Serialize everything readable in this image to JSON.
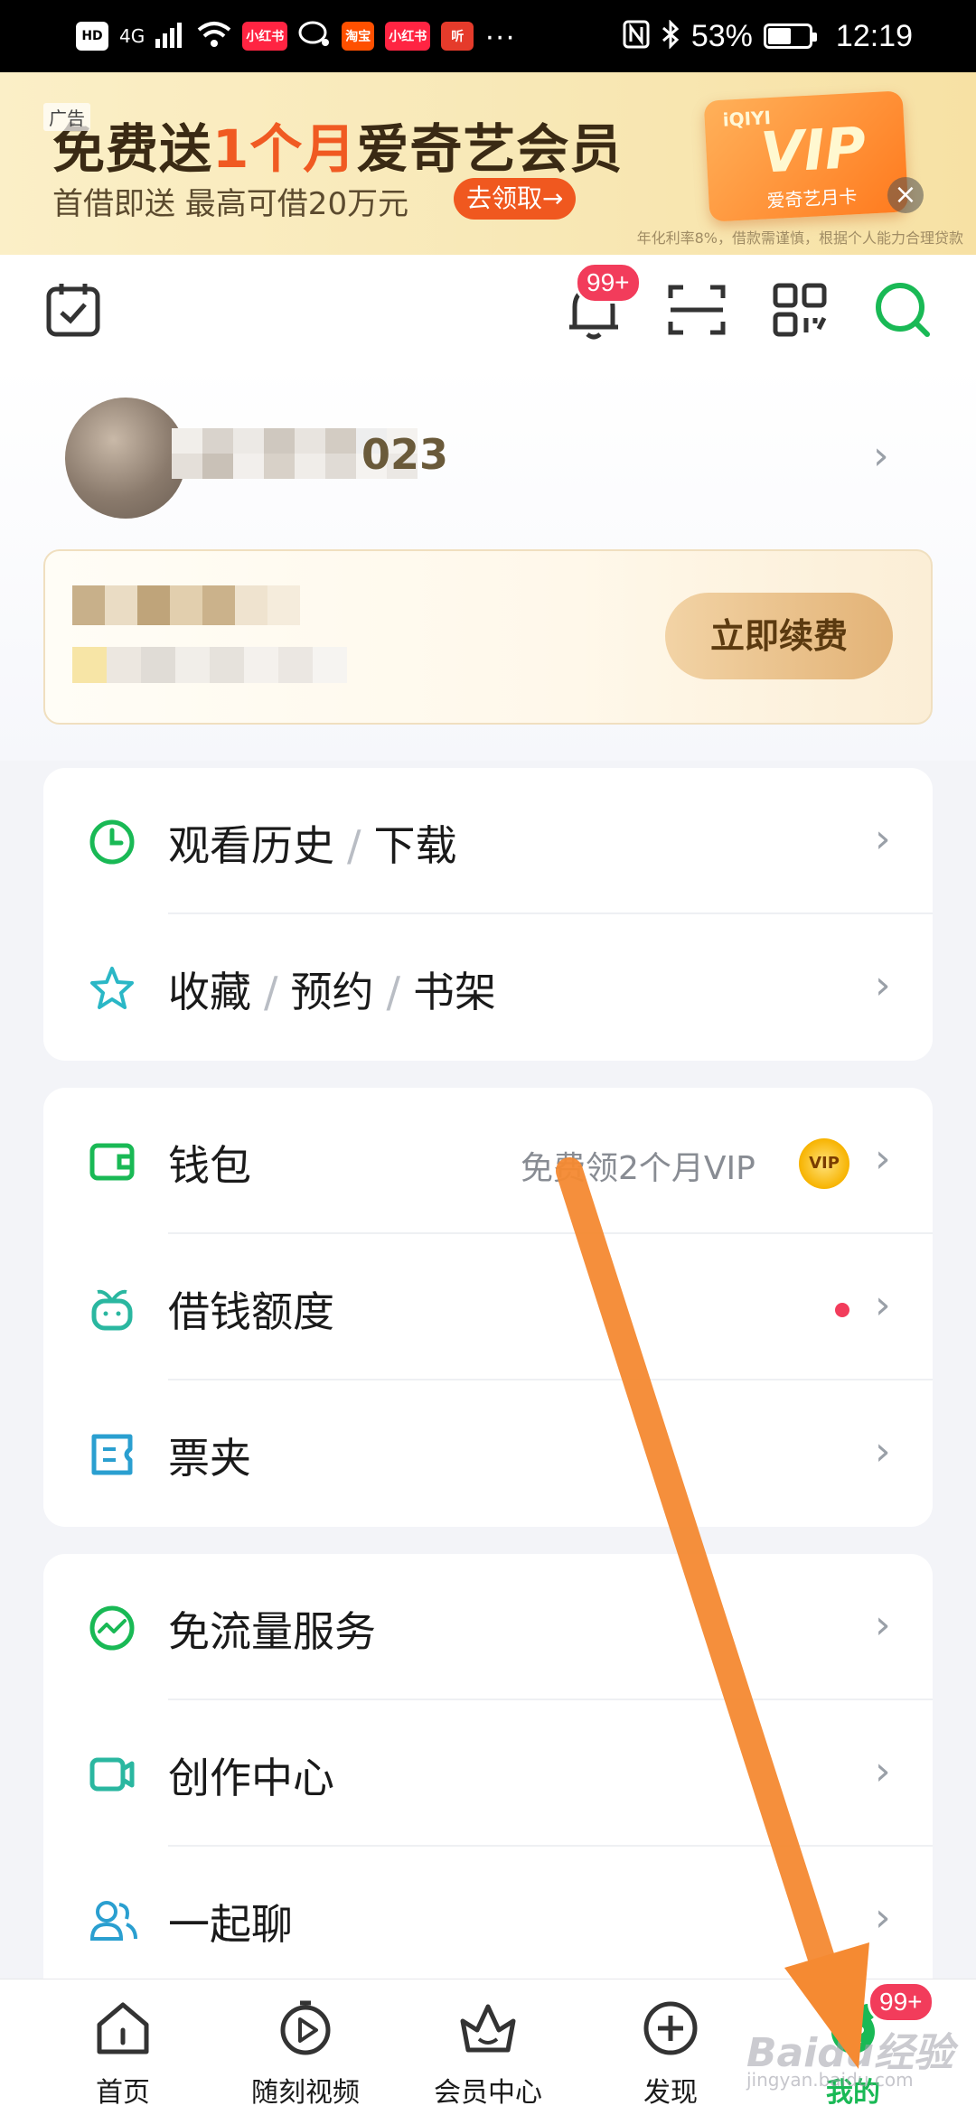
{
  "status_bar": {
    "network_label": "4G",
    "app_chips": [
      "HD",
      "小红书",
      "淘宝",
      "小红书",
      "听"
    ],
    "more": "···",
    "battery": "53%",
    "time": "12:19"
  },
  "ad": {
    "tag": "广告",
    "title_pre": "免费送",
    "title_highlight": "1个月",
    "title_post": "爱奇艺会员",
    "subtitle": "首借即送  最高可借20万元",
    "button": "去领取→",
    "disclaimer": "年化利率8%，借款需谨慎，根据个人能力合理贷款",
    "card_brand": "iQIYI",
    "card_vip": "VIP",
    "card_label": "爱奇艺月卡",
    "close": "×"
  },
  "toolbar": {
    "notification_badge": "99+"
  },
  "profile": {
    "username_visible": "023",
    "renew_button": "立即续费"
  },
  "menu": {
    "group1": [
      {
        "parts": [
          "观看历史",
          "下载"
        ]
      },
      {
        "parts": [
          "收藏",
          "预约",
          "书架"
        ]
      }
    ],
    "separator": "/",
    "wallet": {
      "label": "钱包",
      "promo": "免费领2个月VIP",
      "coin": "VIP"
    },
    "loan": {
      "label": "借钱额度"
    },
    "tickets": {
      "label": "票夹"
    },
    "free_data": {
      "label": "免流量服务"
    },
    "creator": {
      "label": "创作中心"
    },
    "chat": {
      "label": "一起聊"
    }
  },
  "bottom_nav": {
    "tabs": [
      "首页",
      "随刻视频",
      "会员中心",
      "发现",
      "我的"
    ],
    "active": "我的",
    "mine_badge": "99+"
  },
  "watermark": {
    "text": "Baidu经验",
    "sub": "jingyan.baidu.com"
  },
  "colors": {
    "accent_green": "#19b955",
    "badge_red": "#f23c5b",
    "annotation_orange": "#f58a32"
  }
}
